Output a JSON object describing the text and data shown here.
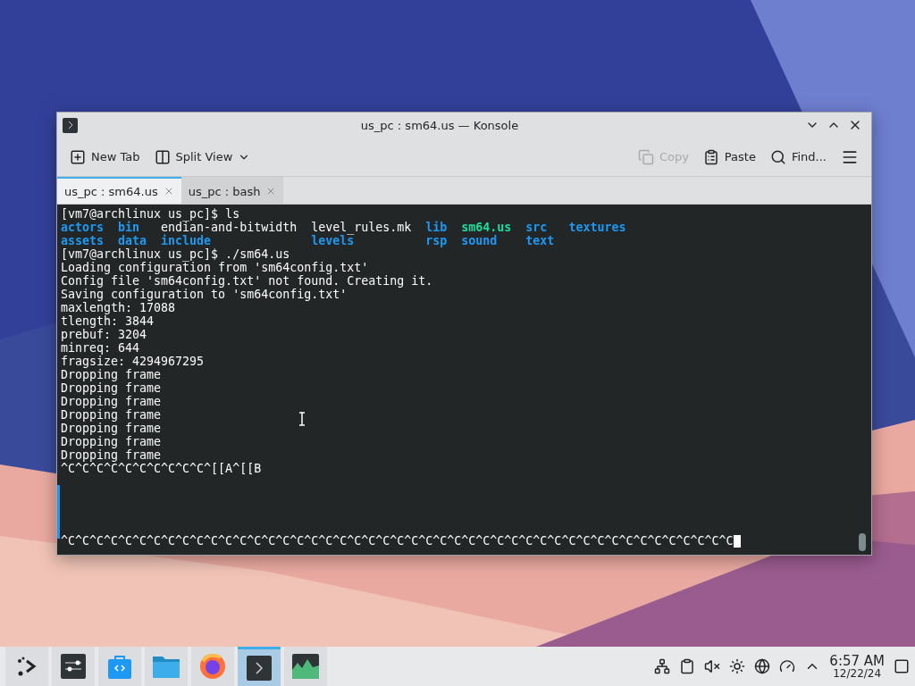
{
  "window": {
    "title": "us_pc : sm64.us — Konsole"
  },
  "toolbar": {
    "left": [
      {
        "label": "New Tab",
        "kind": "newtab"
      },
      {
        "label": "Split View",
        "kind": "split"
      }
    ],
    "right": [
      {
        "label": "Copy",
        "kind": "copy",
        "disabled": true
      },
      {
        "label": "Paste",
        "kind": "paste",
        "disabled": false
      },
      {
        "label": "Find...",
        "kind": "find",
        "disabled": false
      }
    ]
  },
  "tabs": [
    {
      "label": "us_pc : sm64.us",
      "selected": true
    },
    {
      "label": "us_pc : bash",
      "selected": false
    }
  ],
  "terminal": {
    "before": [
      "[vm7@archlinux us_pc]$ ls"
    ],
    "ls_columns": [
      [
        {
          "name": "actors",
          "kind": "dir"
        },
        {
          "name": "assets",
          "kind": "dir"
        }
      ],
      [
        {
          "name": "bin",
          "kind": "dir"
        },
        {
          "name": "data",
          "kind": "dir"
        }
      ],
      [
        {
          "name": "endian-and-bitwidth",
          "kind": "file"
        },
        {
          "name": "include",
          "kind": "dir"
        }
      ],
      [
        {
          "name": "level_rules.mk",
          "kind": "file"
        },
        {
          "name": "levels",
          "kind": "dir"
        }
      ],
      [
        {
          "name": "lib",
          "kind": "dir"
        },
        {
          "name": "rsp",
          "kind": "dir"
        }
      ],
      [
        {
          "name": "sm64.us",
          "kind": "exec"
        },
        {
          "name": "sound",
          "kind": "dir"
        }
      ],
      [
        {
          "name": "src",
          "kind": "dir"
        },
        {
          "name": "text",
          "kind": "dir"
        }
      ],
      [
        {
          "name": "textures",
          "kind": "dir"
        }
      ]
    ],
    "after": [
      "[vm7@archlinux us_pc]$ ./sm64.us",
      "Loading configuration from 'sm64config.txt'",
      "Config file 'sm64config.txt' not found. Creating it.",
      "Saving configuration to 'sm64config.txt'",
      "maxlength: 17088",
      "tlength: 3844",
      "prebuf: 3204",
      "minreq: 644",
      "fragsize: 4294967295",
      "Dropping frame",
      "Dropping frame",
      "Dropping frame",
      "Dropping frame",
      "Dropping frame",
      "Dropping frame",
      "Dropping frame",
      "^C^C^C^C^C^C^C^C^C^C^[[A^[[B"
    ],
    "last_line": "^C^C^C^C^C^C^C^C^C^C^C^C^C^C^C^C^C^C^C^C^C^C^C^C^C^C^C^C^C^C^C^C^C^C^C^C^C^C^C^C^C^C^C^C^C^C^C"
  },
  "taskbar": {
    "apps": [
      {
        "kind": "launcher",
        "selected": false
      },
      {
        "kind": "settings",
        "selected": false
      },
      {
        "kind": "store",
        "selected": false
      },
      {
        "kind": "files",
        "selected": false
      },
      {
        "kind": "browser",
        "selected": false
      },
      {
        "kind": "terminal",
        "selected": true
      },
      {
        "kind": "monitor",
        "selected": false
      }
    ],
    "clock": {
      "time": "6:57 AM",
      "date": "12/22/24"
    }
  }
}
